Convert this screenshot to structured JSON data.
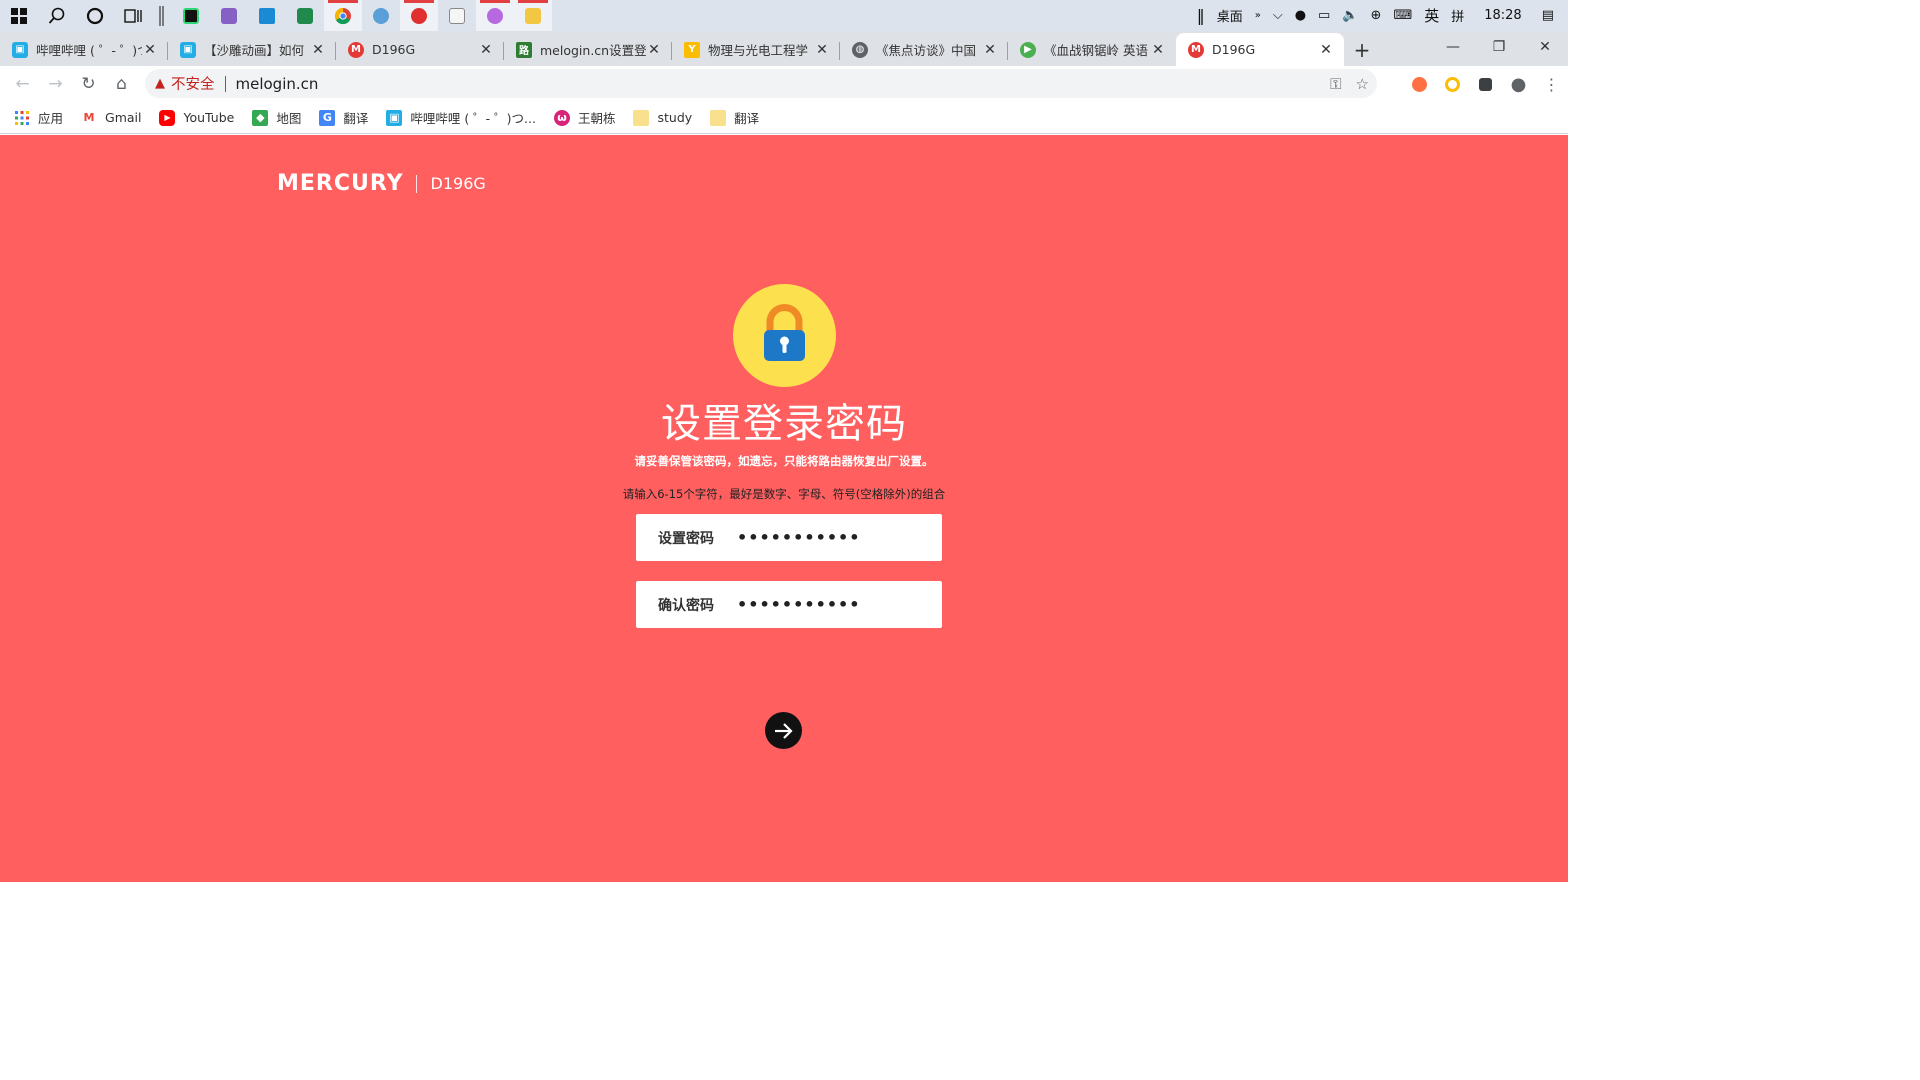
{
  "taskbar": {
    "desktop_label": "桌面",
    "ime_lang": "英",
    "ime_mode": "拼",
    "clock": "18:28"
  },
  "tabs": [
    {
      "title": "哔哩哔哩 ( ゜- ゜)つ",
      "favicon_color": "#23ade5",
      "active": false
    },
    {
      "title": "【沙雕动画】如何",
      "favicon_color": "#23ade5",
      "active": false
    },
    {
      "title": "D196G",
      "favicon_color": "#e53935",
      "active": false
    },
    {
      "title": "melogin.cn设置登",
      "favicon_color": "#2e7d32",
      "active": false
    },
    {
      "title": "物理与光电工程学",
      "favicon_color": "#fbbc04",
      "active": false
    },
    {
      "title": "《焦点访谈》中国",
      "favicon_color": "#5f6368",
      "active": false
    },
    {
      "title": "《血战钢锯岭 英语",
      "favicon_color": "#4caf50",
      "active": false
    },
    {
      "title": "D196G",
      "favicon_color": "#e53935",
      "active": true
    }
  ],
  "address": {
    "security_label": "不安全",
    "url": "melogin.cn"
  },
  "bookmarks": [
    {
      "label": "应用",
      "icon": "apps-grid-icon"
    },
    {
      "label": "Gmail",
      "icon": "gmail-icon"
    },
    {
      "label": "YouTube",
      "icon": "youtube-icon"
    },
    {
      "label": "地图",
      "icon": "maps-icon"
    },
    {
      "label": "翻译",
      "icon": "translate-icon"
    },
    {
      "label": "哔哩哔哩 ( ゜- ゜)つ...",
      "icon": "bilibili-icon"
    },
    {
      "label": "王朝栋",
      "icon": "profile-icon"
    },
    {
      "label": "study",
      "icon": "folder-icon"
    },
    {
      "label": "翻译",
      "icon": "folder-icon"
    }
  ],
  "router": {
    "brand": "MERCURY",
    "model": "D196G",
    "heading": "设置登录密码",
    "notice": "请妥善保管该密码，如遗忘，只能将路由器恢复出厂设置。",
    "hint": "请输入6-15个字符，最好是数字、字母、符号(空格除外)的组合",
    "password_label": "设置密码",
    "password_value": "•••••••••••",
    "confirm_label": "确认密码",
    "confirm_value": "•••••••••••",
    "background_color": "#ff5f5f",
    "lock_circle_color": "#fde04e"
  }
}
